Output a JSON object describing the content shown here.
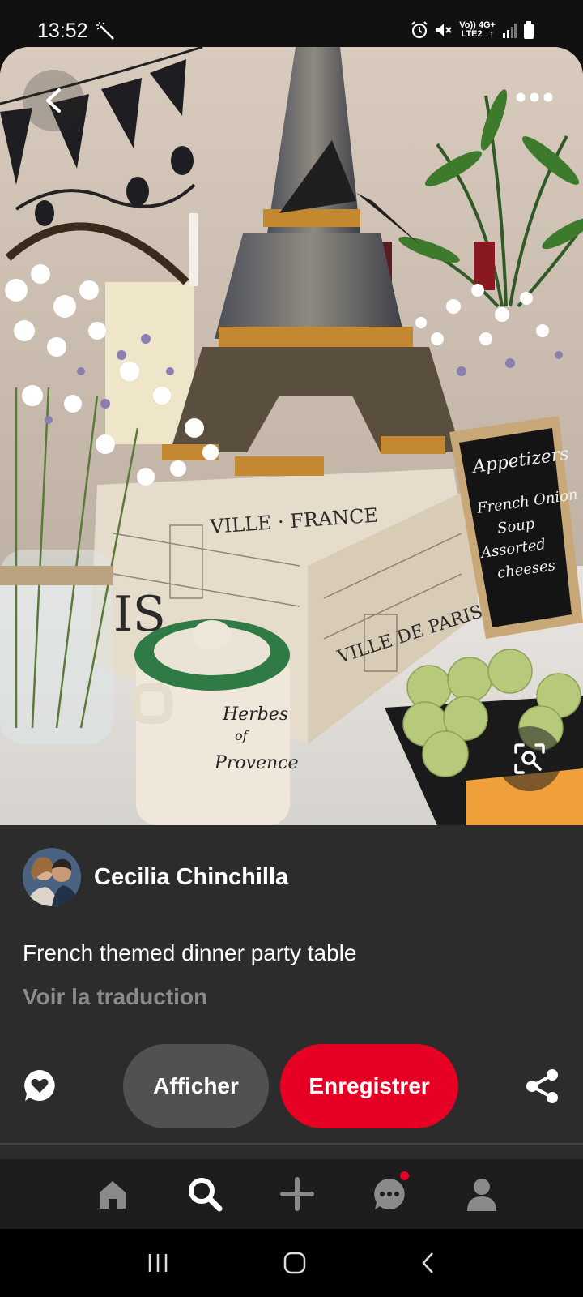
{
  "status_bar": {
    "time": "13:52",
    "net_top": "Vo)) 4G+",
    "net_bottom": "LTE2 ↓↑",
    "icons": [
      "magic-wand-icon",
      "alarm-icon",
      "mute-icon",
      "signal-icon",
      "battery-icon"
    ]
  },
  "photo": {
    "description_icons": [
      "back-arrow-icon",
      "more-dots-icon",
      "visual-search-icon"
    ],
    "chalkboard": [
      "Appetizers",
      "French Onion",
      "Soup",
      "Assorted",
      "cheeses"
    ],
    "jar_label": [
      "Herbes",
      "of",
      "Provence"
    ]
  },
  "pin": {
    "author": "Cecilia Chinchilla",
    "title": "French themed dinner party table",
    "translate": "Voir la traduction",
    "visit_label": "Afficher",
    "save_label": "Enregistrer"
  },
  "bottom_nav": {
    "items": [
      "home-icon",
      "search-icon",
      "add-icon",
      "messages-icon",
      "profile-icon"
    ],
    "messages_notification": true
  },
  "colors": {
    "save": "#e60023",
    "panel": "#2c2c2c",
    "visit": "#515151"
  }
}
